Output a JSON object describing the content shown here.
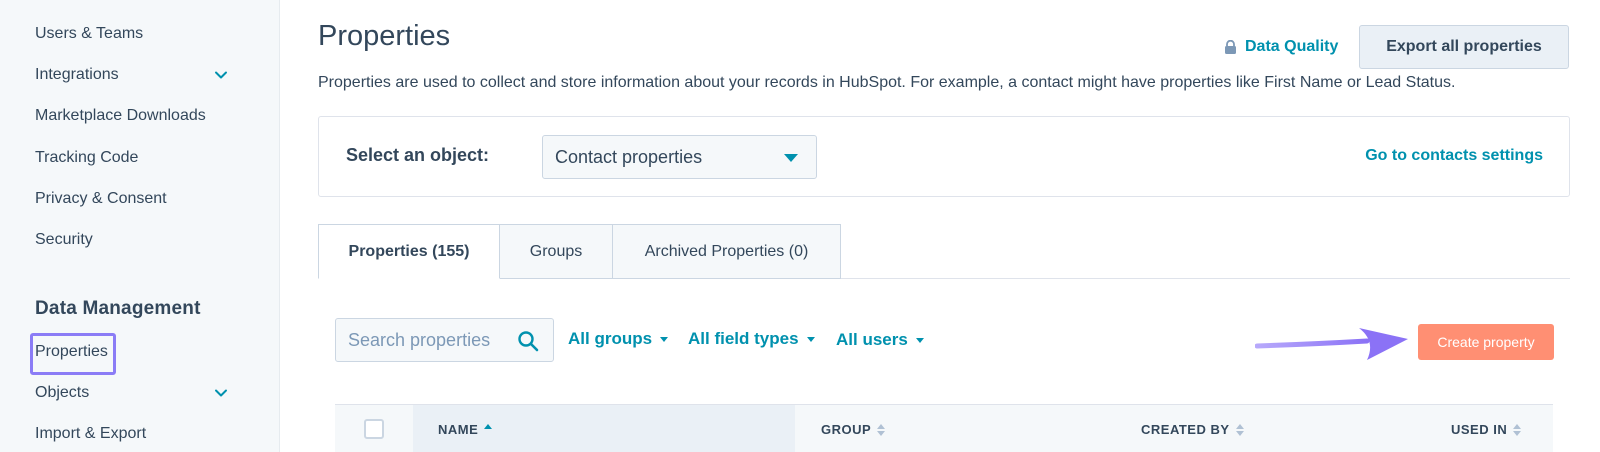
{
  "sidebar": {
    "items": [
      {
        "label": "Users & Teams"
      },
      {
        "label": "Integrations"
      },
      {
        "label": "Marketplace Downloads"
      },
      {
        "label": "Tracking Code"
      },
      {
        "label": "Privacy & Consent"
      },
      {
        "label": "Security"
      }
    ],
    "section_title": "Data Management",
    "data_items": [
      {
        "label": "Properties"
      },
      {
        "label": "Objects"
      },
      {
        "label": "Import & Export"
      }
    ]
  },
  "header": {
    "title": "Properties",
    "data_quality_label": "Data Quality",
    "export_label": "Export all properties",
    "description": "Properties are used to collect and store information about your records in HubSpot. For example, a contact might have properties like First Name or Lead Status."
  },
  "object_selector": {
    "label": "Select an object:",
    "selected": "Contact properties",
    "settings_link": "Go to contacts settings"
  },
  "tabs": [
    {
      "label": "Properties (155)"
    },
    {
      "label": "Groups"
    },
    {
      "label": "Archived Properties (0)"
    }
  ],
  "filters": {
    "search_placeholder": "Search properties",
    "groups": "All groups",
    "field_types": "All field types",
    "users": "All users"
  },
  "create_label": "Create property",
  "table": {
    "columns": [
      "NAME",
      "GROUP",
      "CREATED BY",
      "USED IN"
    ]
  },
  "colors": {
    "accent": "#0091ae",
    "create_button": "#ff8f73",
    "highlight": "#8b7cf6"
  }
}
